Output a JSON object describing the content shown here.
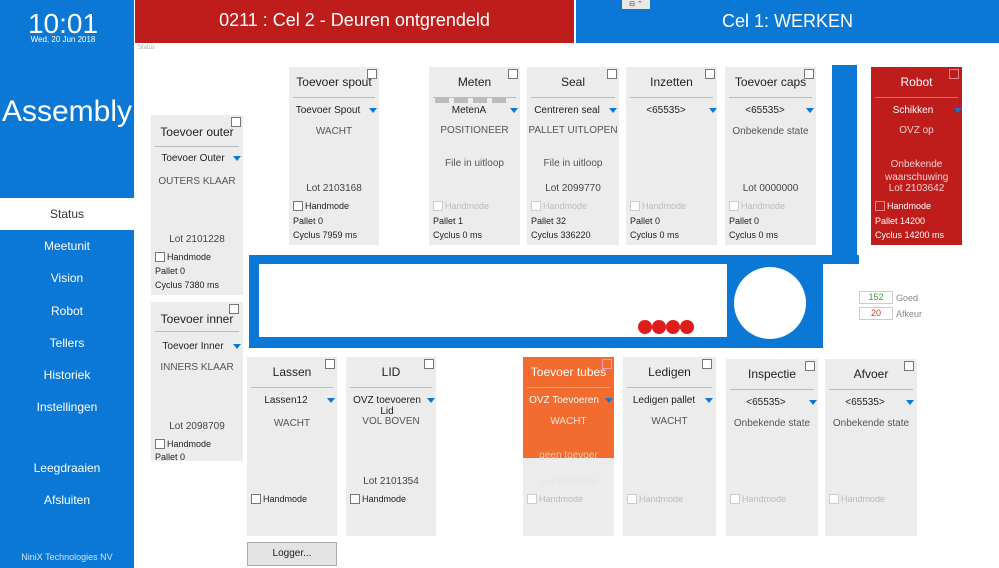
{
  "clock": {
    "time": "10:01",
    "date": "Wed, 20 Jun 2018"
  },
  "app_title": "Assembly",
  "nav": [
    "Status",
    "Meetunit",
    "Vision",
    "Robot",
    "Tellers",
    "Historiek",
    "Instellingen",
    "Leegdraaien",
    "Afsluiten"
  ],
  "company": "NiniX Technologies NV",
  "header": {
    "cell2": "0211 : Cel 2 - Deuren ontgrendeld",
    "cell1": "Cel 1: WERKEN",
    "window_controls": "⊟ ⌃",
    "status_label": "Status"
  },
  "cards": {
    "toevoer_outer": {
      "title": "Toevoer outer",
      "selected": "Toevoer Outer",
      "state": "OUTERS KLAAR",
      "lot": "Lot 2101228",
      "handmode": "Handmode",
      "pallet": "Pallet 0",
      "cyclus": "Cyclus 7380 ms"
    },
    "toevoer_inner": {
      "title": "Toevoer inner",
      "selected": "Toevoer Inner",
      "state": "INNERS KLAAR",
      "lot": "Lot 2098709",
      "handmode": "Handmode",
      "pallet": "Pallet 0"
    },
    "toevoer_spout": {
      "title": "Toevoer spout",
      "selected": "Toevoer Spout",
      "state": "WACHT",
      "lot": "Lot 2103168",
      "handmode": "Handmode",
      "pallet": "Pallet 0",
      "cyclus": "Cyclus 7959 ms"
    },
    "meten": {
      "title": "Meten",
      "selected": "MetenA",
      "state": "POSITIONEER",
      "state2": "File in uitloop",
      "handmode": "Handmode",
      "pallet": "Pallet 1",
      "cyclus": "Cyclus 0 ms"
    },
    "seal": {
      "title": "Seal",
      "selected": "Centreren seal",
      "state": "PALLET UITLOPEN",
      "state2": "File in uitloop",
      "lot": "Lot 2099770",
      "handmode": "Handmode",
      "pallet": "Pallet 32",
      "cyclus": "Cyclus 336220"
    },
    "inzetten": {
      "title": "Inzetten",
      "selected": "<65535>",
      "handmode": "Handmode",
      "pallet": "Pallet 0",
      "cyclus": "Cyclus 0 ms"
    },
    "toevoer_caps": {
      "title": "Toevoer caps",
      "selected": "<65535>",
      "state": "Onbekende state",
      "lot": "Lot 0000000",
      "handmode": "Handmode",
      "pallet": "Pallet 0",
      "cyclus": "Cyclus 0 ms"
    },
    "robot": {
      "title": "Robot",
      "selected": "Schikken",
      "state": "OVZ op",
      "state2": "Onbekende waarschuwing",
      "lot": "Lot 2103642",
      "handmode": "Handmode",
      "pallet": "Pallet 14200",
      "cyclus": "Cyclus 14200 ms"
    },
    "lassen": {
      "title": "Lassen",
      "selected": "Lassen12",
      "state": "WACHT",
      "handmode": "Handmode"
    },
    "lid": {
      "title": "LID",
      "selected": "OVZ toevoeren Lid",
      "state": "VOL BOVEN",
      "lot": "Lot 2101354",
      "handmode": "Handmode"
    },
    "toevoer_tubes": {
      "title": "Toevoer tubes",
      "selected": "OVZ Toevoeren",
      "state": "WACHT",
      "state2": "geen toevoer",
      "lot": "Lot 2103133",
      "handmode": "Handmode"
    },
    "ledigen": {
      "title": "Ledigen",
      "selected": "Ledigen pallet",
      "state": "WACHT",
      "handmode": "Handmode"
    },
    "inspectie": {
      "title": "Inspectie",
      "selected": "<65535>",
      "state": "Onbekende state",
      "handmode": "Handmode"
    },
    "afvoer": {
      "title": "Afvoer",
      "selected": "<65535>",
      "state": "Onbekende state",
      "handmode": "Handmode"
    }
  },
  "counters": {
    "goed_value": "152",
    "goed_label": "Goed",
    "afkeur_value": "20",
    "afkeur_label": "Afkeur"
  },
  "logger_label": "Logger...",
  "colors": {
    "blue": "#0c78d6",
    "red": "#bf1c1c",
    "orange": "#f26b2f",
    "pallet_dot": "#e01b1b",
    "goed": "#3a9a3a",
    "afkeur": "#c0392b"
  }
}
